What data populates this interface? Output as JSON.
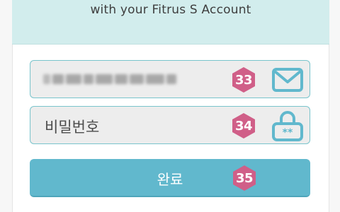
{
  "header": {
    "subtitle": "with your Fitrus S Account"
  },
  "email_field": {
    "value_note": "",
    "badge": "33",
    "icon": "envelope-icon"
  },
  "password_field": {
    "placeholder": "비밀번호",
    "badge": "34",
    "icon": "lock-icon"
  },
  "submit_button": {
    "label": "완료",
    "badge": "35"
  },
  "colors": {
    "accent": "#61b8cd",
    "badge": "#d05f88",
    "header_bg": "#d2eded",
    "field_border": "#79c4cc"
  }
}
